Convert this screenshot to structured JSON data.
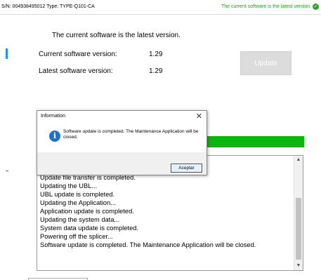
{
  "topbar": {
    "serial_text": "S/N: 004938495012   Type:  TYPE-Q101-CA",
    "status_text": "The current software is the latest version.",
    "status_color": "#1aa11a",
    "status_icon": "check-circle-icon"
  },
  "main": {
    "message": "The current software is the latest version.",
    "current_label": "Current software version:",
    "current_value": "1.29",
    "latest_label": "Latest software version:",
    "latest_value": "1.29",
    "update_button": "Update",
    "progress_fraction": 1.0,
    "progress_color": "#0fb50f"
  },
  "log": {
    "lines": [
      "Update file transfer is completed.",
      "Updating the UBL...",
      "UBL update is completed.",
      "Updating the Application...",
      "Application update is completed.",
      "Updating the system data...",
      "System data update is completed.",
      "Powering off the splicer...",
      "Software update is completed. The Maintenance Application will be closed."
    ]
  },
  "dialog": {
    "title": "Information",
    "message": "Software update is completed. The Maintenance Application will be closed.",
    "icon": "info-icon",
    "accept_button": "Aceptar"
  }
}
